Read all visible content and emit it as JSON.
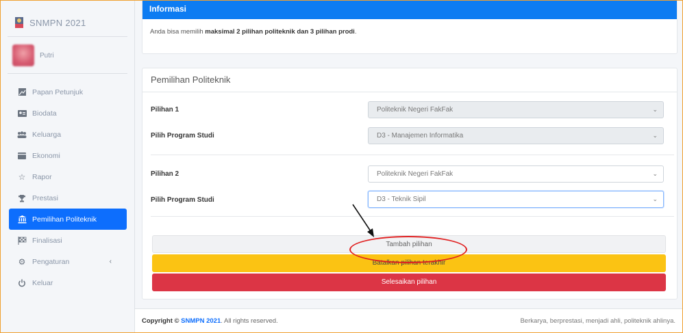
{
  "brand": {
    "name": "SNMPN 2021",
    "logo_icon": "university-logo-icon"
  },
  "user": {
    "name": "Putri"
  },
  "sidebar": {
    "items": [
      {
        "label": "Papan Petunjuk",
        "icon": "dashboard-icon"
      },
      {
        "label": "Biodata",
        "icon": "id-card-icon"
      },
      {
        "label": "Keluarga",
        "icon": "users-icon"
      },
      {
        "label": "Ekonomi",
        "icon": "wallet-icon"
      },
      {
        "label": "Rapor",
        "icon": "star-icon"
      },
      {
        "label": "Prestasi",
        "icon": "trophy-icon"
      },
      {
        "label": "Pemilihan Politeknik",
        "icon": "university-icon",
        "active": true
      },
      {
        "label": "Finalisasi",
        "icon": "flag-checkered-icon"
      },
      {
        "label": "Pengaturan",
        "icon": "gear-icon",
        "chevron": "‹"
      },
      {
        "label": "Keluar",
        "icon": "power-icon"
      }
    ]
  },
  "info_card": {
    "title": "Informasi",
    "text_prefix": "Anda bisa memilih ",
    "text_bold": "maksimal 2 pilihan politeknik dan 3 pilihan prodi",
    "text_suffix": "."
  },
  "selection_card": {
    "title": "Pemilihan Politeknik",
    "pilihan1_label": "Pilihan 1",
    "pilihan1_value": "Politeknik Negeri FakFak",
    "prodi1_label": "Pilih Program Studi",
    "prodi1_value": "D3 - Manajemen Informatika",
    "pilihan2_label": "Pilihan 2",
    "pilihan2_value": "Politeknik Negeri FakFak",
    "prodi2_label": "Pilih Program Studi",
    "prodi2_value": "D3 - Teknik Sipil",
    "btn_add": "Tambah pilihan",
    "btn_cancel": "Batalkan pilihan terakhir",
    "btn_finish": "Selesaikan pilihan"
  },
  "footer": {
    "copyright_prefix": "Copyright © ",
    "copyright_brand": "SNMPN 2021",
    "copyright_suffix": ". All rights reserved.",
    "tagline": "Berkarya, berprestasi, menjadi ahli, politeknik ahlinya."
  },
  "colors": {
    "primary": "#0d6efd",
    "warning": "#fbc313",
    "danger": "#dc3545",
    "annotation": "#e02020"
  }
}
